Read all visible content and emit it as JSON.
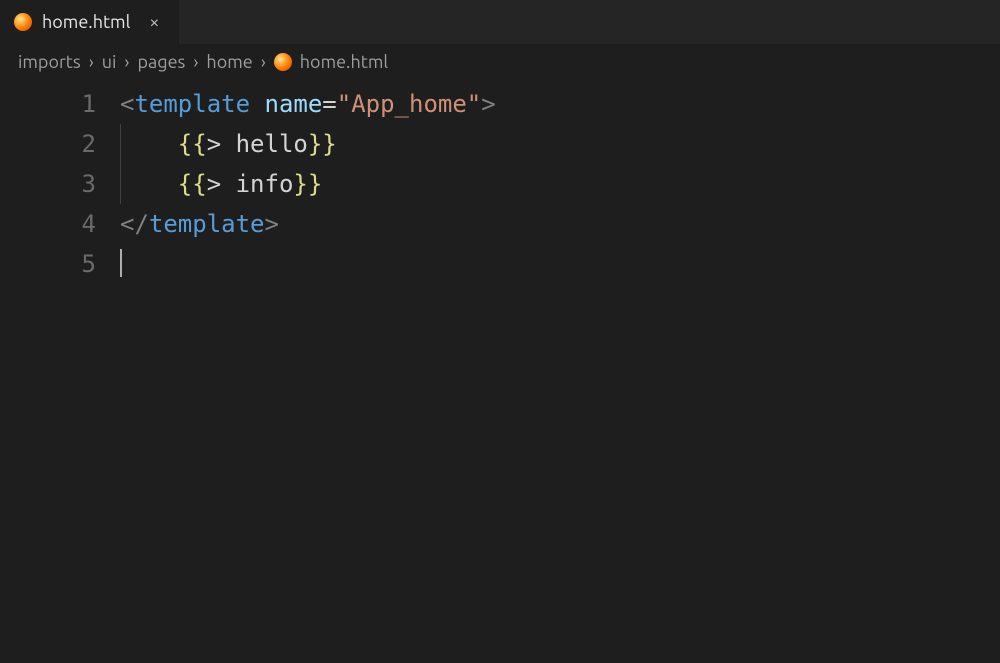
{
  "tab": {
    "filename": "home.html",
    "close_glyph": "×"
  },
  "breadcrumbs": {
    "segments": [
      "imports",
      "ui",
      "pages",
      "home"
    ],
    "filename": "home.html",
    "separator": "›"
  },
  "gutter": {
    "lines": [
      "1",
      "2",
      "3",
      "4",
      "5"
    ]
  },
  "code": {
    "line1": {
      "open": "<",
      "tag": "template",
      "space": " ",
      "attr": "name",
      "eq": "=",
      "str": "\"App_home\"",
      "close": ">"
    },
    "line2": {
      "indent": "    ",
      "open": "{{",
      "body": "> hello",
      "close": "}}"
    },
    "line3": {
      "indent": "    ",
      "open": "{{",
      "body": "> info",
      "close": "}}"
    },
    "line4": {
      "open": "</",
      "tag": "template",
      "close": ">"
    }
  }
}
